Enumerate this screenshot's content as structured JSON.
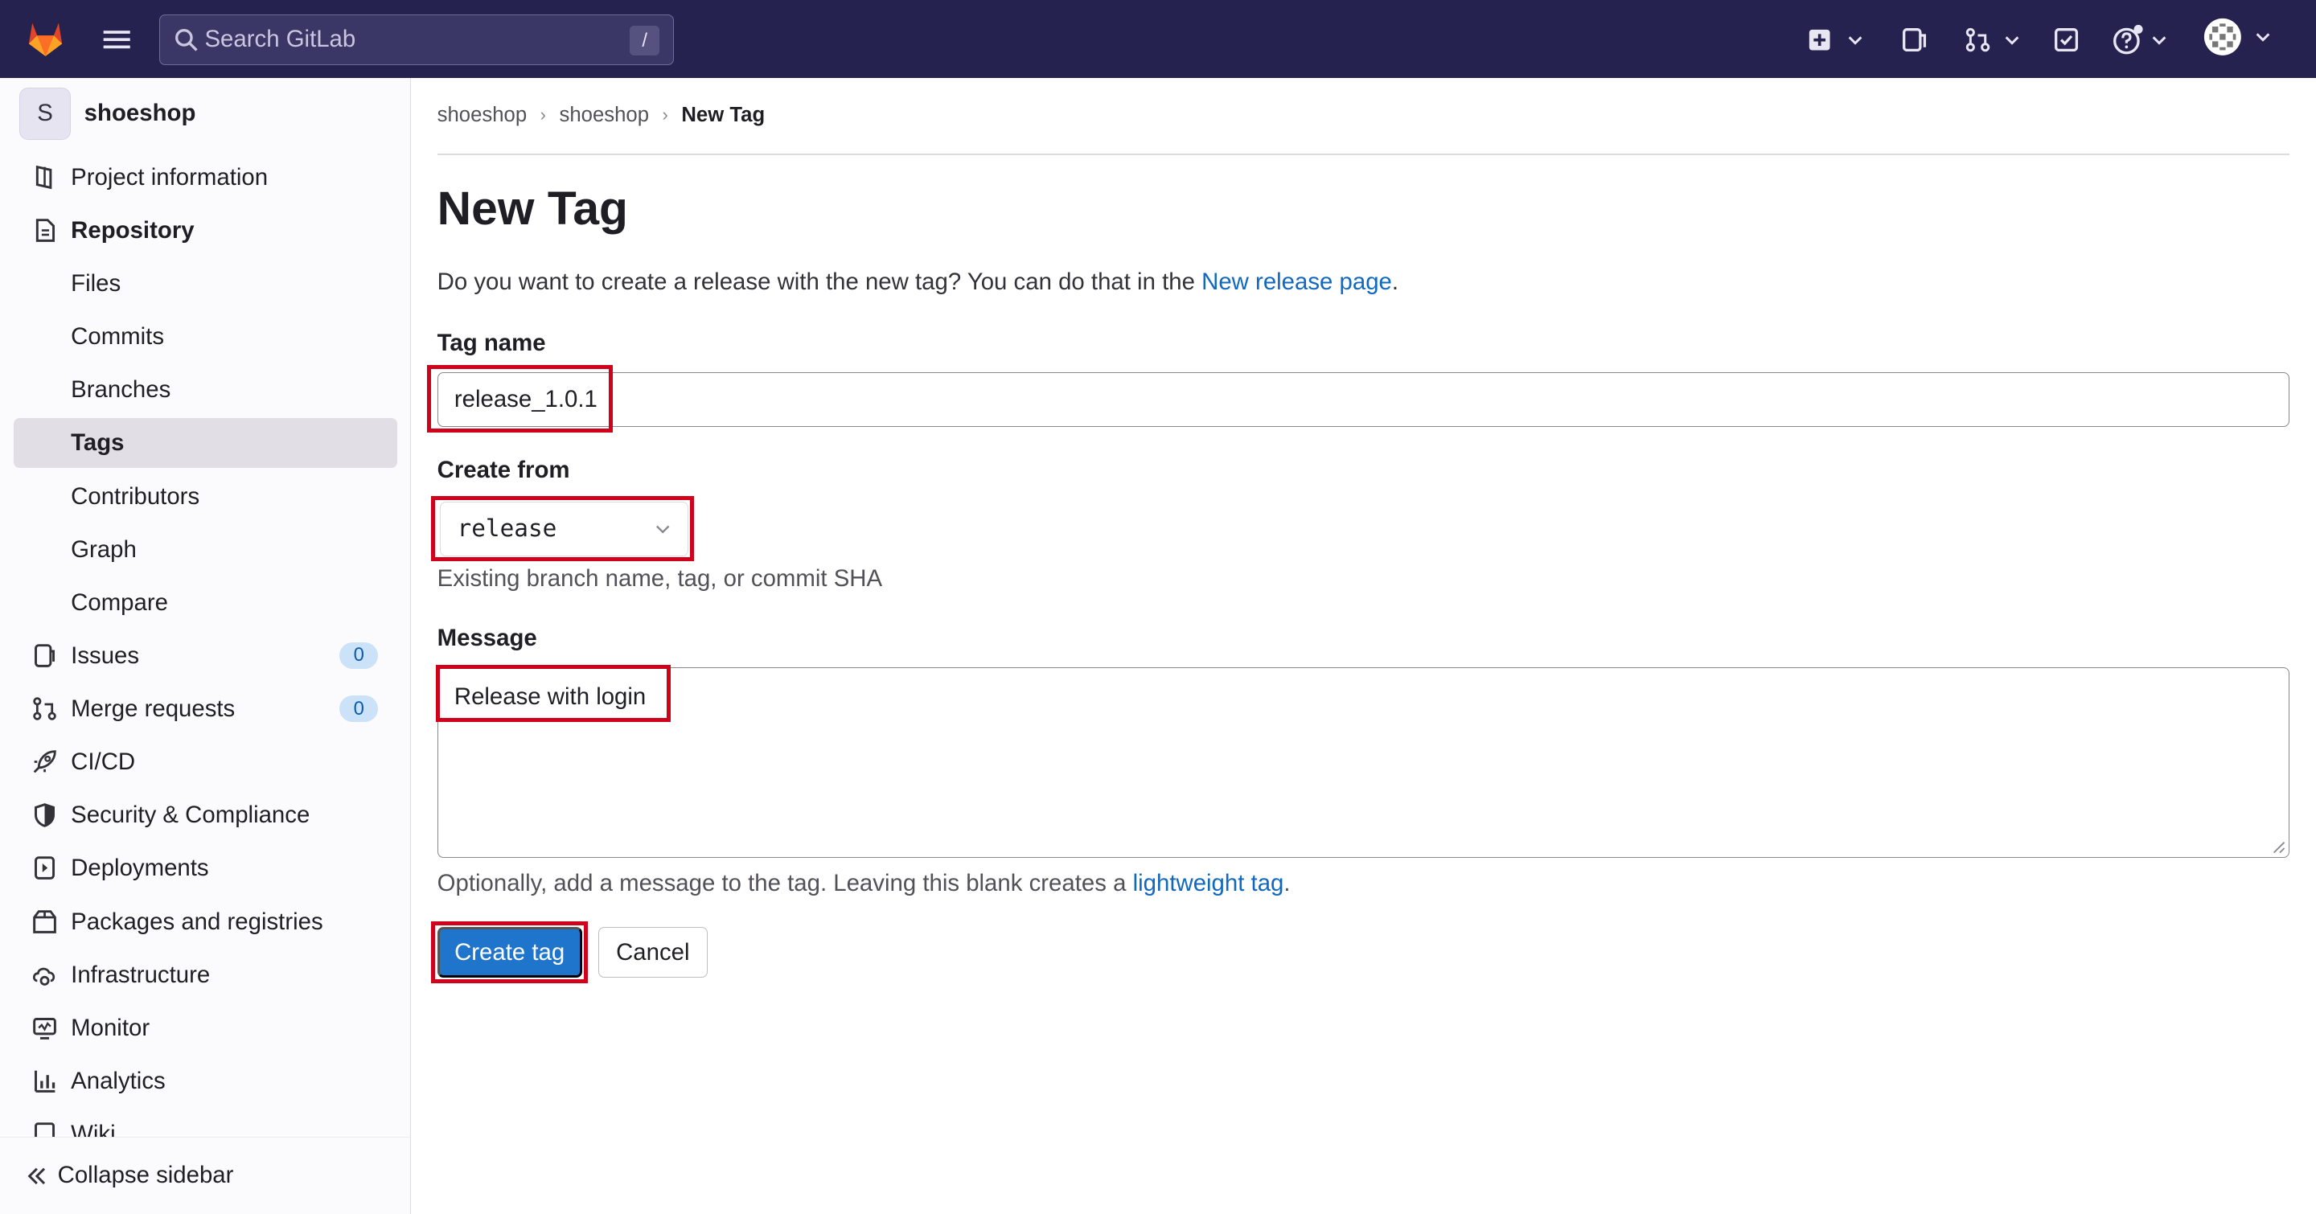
{
  "topbar": {
    "search_placeholder": "Search GitLab",
    "search_shortcut": "/",
    "icons": [
      "gitlab-tanuki-icon",
      "hamburger-icon",
      "plus-square-icon",
      "issues-icon",
      "merge-request-icon",
      "todo-icon",
      "help-icon",
      "user-avatar"
    ]
  },
  "sidebar": {
    "project_initial": "S",
    "project_name": "shoeshop",
    "items": [
      {
        "label": "Project information",
        "icon": "project-info-icon"
      },
      {
        "label": "Repository",
        "icon": "repository-icon"
      },
      {
        "label": "Files"
      },
      {
        "label": "Commits"
      },
      {
        "label": "Branches"
      },
      {
        "label": "Tags"
      },
      {
        "label": "Contributors"
      },
      {
        "label": "Graph"
      },
      {
        "label": "Compare"
      },
      {
        "label": "Issues",
        "icon": "issues-icon",
        "count": "0"
      },
      {
        "label": "Merge requests",
        "icon": "merge-request-icon",
        "count": "0"
      },
      {
        "label": "CI/CD",
        "icon": "rocket-icon"
      },
      {
        "label": "Security & Compliance",
        "icon": "shield-icon"
      },
      {
        "label": "Deployments",
        "icon": "deployments-icon"
      },
      {
        "label": "Packages and registries",
        "icon": "package-icon"
      },
      {
        "label": "Infrastructure",
        "icon": "cloud-gear-icon"
      },
      {
        "label": "Monitor",
        "icon": "monitor-icon"
      },
      {
        "label": "Analytics",
        "icon": "chart-icon"
      },
      {
        "label": "Wiki",
        "icon": "book-icon"
      }
    ],
    "collapse_label": "Collapse sidebar"
  },
  "breadcrumb": [
    "shoeshop",
    "shoeshop",
    "New Tag"
  ],
  "page": {
    "title": "New Tag",
    "intro_text": "Do you want to create a release with the new tag? You can do that in the",
    "intro_link": "New release page",
    "intro_end": ".",
    "tag_name_label": "Tag name",
    "tag_name_value": "release_1.0.1",
    "create_from_label": "Create from",
    "create_from_value": "release",
    "create_from_help": "Existing branch name, tag, or commit SHA",
    "message_label": "Message",
    "message_value": "Release with login",
    "message_help": "Optionally, add a message to the tag. Leaving this blank creates a",
    "message_help_link": "lightweight tag",
    "message_help_end": ".",
    "create_button": "Create tag",
    "cancel_button": "Cancel"
  },
  "colors": {
    "topbar": "#25224f",
    "primary": "#1f75cb",
    "link": "#1068bf",
    "highlight": "#d0021b"
  }
}
